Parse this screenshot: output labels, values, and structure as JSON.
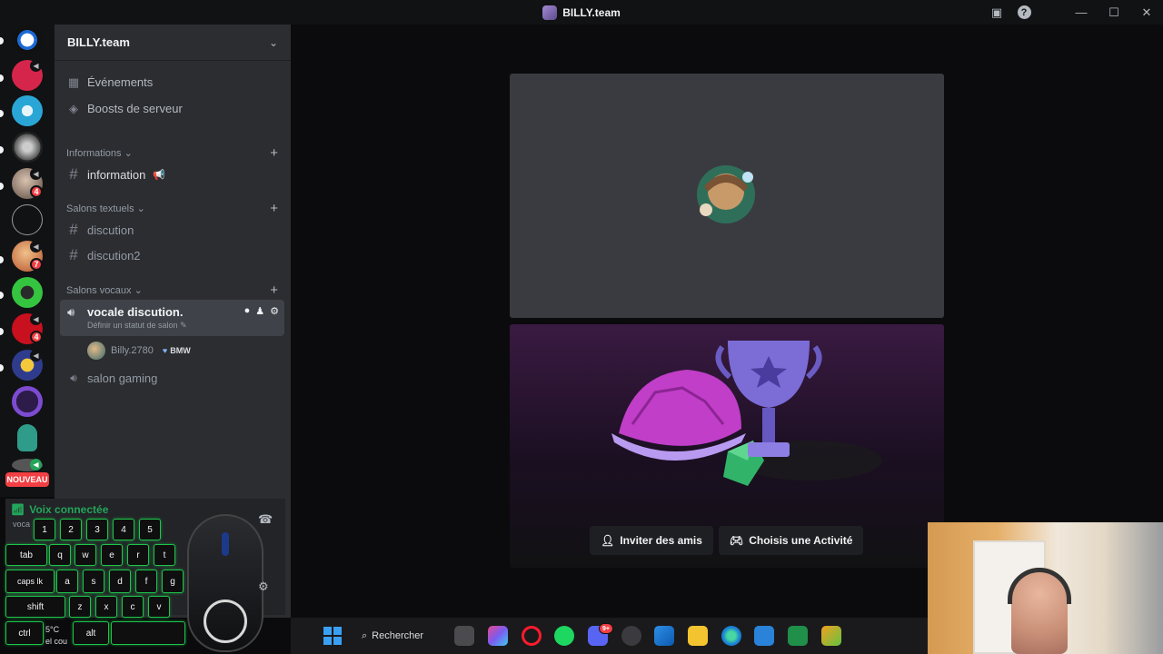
{
  "window": {
    "title": "BILLY.team"
  },
  "server": {
    "name": "BILLY.team"
  },
  "menu": {
    "events": "Événements",
    "boosts": "Boosts de serveur"
  },
  "categories": {
    "info": "Informations",
    "text": "Salons textuels",
    "voice": "Salons vocaux"
  },
  "channels": {
    "info": [
      {
        "label": "information",
        "emoji": "📢"
      }
    ],
    "text": [
      {
        "label": "discution"
      },
      {
        "label": "discution2"
      }
    ],
    "voice": [
      {
        "label": "vocale discution.",
        "status": "Définir un statut de salon",
        "active": true
      },
      {
        "label": "salon gaming"
      }
    ]
  },
  "voice_user": {
    "name": "Billy.2780",
    "tag": "BMW"
  },
  "rail": {
    "badges": [
      "4",
      "7",
      "4"
    ],
    "nouveau": "NOUVEAU"
  },
  "voice_panel": {
    "status": "Voix connectée",
    "sub": "voca"
  },
  "keyboard": {
    "rows": [
      [
        "1",
        "2",
        "3",
        "4",
        "5"
      ],
      [
        "tab",
        "q",
        "w",
        "e",
        "r",
        "t"
      ],
      [
        "caps lk",
        "a",
        "s",
        "d",
        "f",
        "g"
      ],
      [
        "shift",
        "z",
        "x",
        "c",
        "v"
      ],
      [
        "ctrl",
        "alt"
      ]
    ]
  },
  "overlay_fragments": {
    "temp": "5°C",
    "sub": "el cou"
  },
  "actions": {
    "invite": "Inviter des amis",
    "activity": "Choisis une Activité"
  },
  "taskbar": {
    "search": "Rechercher",
    "discord_badge": "9+"
  },
  "colors": {
    "accent_green": "#23a55a",
    "badge_red": "#f23f43",
    "sidebar": "#2b2d31",
    "rail": "#111214"
  }
}
